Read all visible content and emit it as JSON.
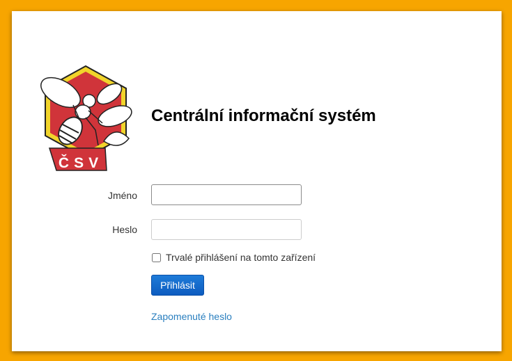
{
  "app": {
    "title": "Centrální informační systém",
    "logo_text": "ČSV"
  },
  "form": {
    "name_label": "Jméno",
    "name_value": "",
    "password_label": "Heslo",
    "password_value": "",
    "remember_label": "Trvalé přihlášení na tomto zařízení",
    "remember_checked": false,
    "login_button": "Přihlásit",
    "forgot_link": "Zapomenuté heslo"
  },
  "colors": {
    "background": "#f7a500",
    "logo_red": "#d0343a",
    "logo_yellow": "#f1d42b",
    "button_blue": "#1467cc",
    "link_blue": "#2a7fbf"
  }
}
